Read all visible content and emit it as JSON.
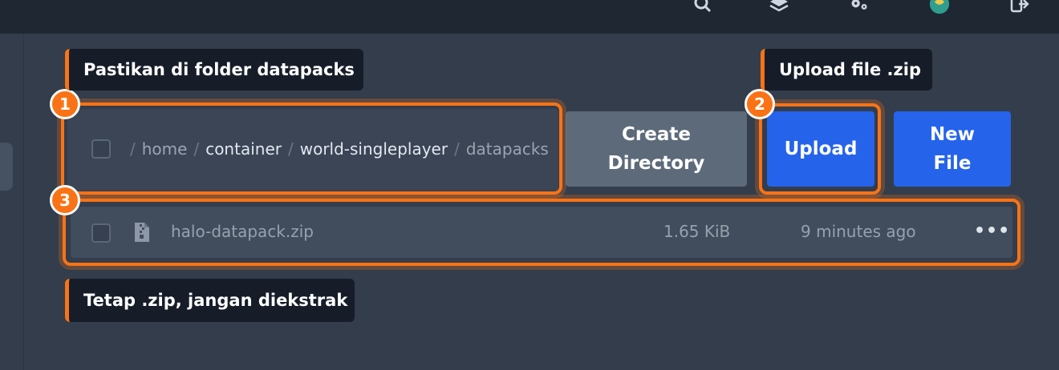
{
  "top_icons": [
    "search-icon",
    "layers-icon",
    "gears-icon",
    "avatar",
    "logout-icon"
  ],
  "breadcrumb": [
    {
      "text": "home",
      "style": "dim"
    },
    {
      "text": "container",
      "style": "bright"
    },
    {
      "text": "world-singleplayer",
      "style": "bright"
    },
    {
      "text": "datapacks",
      "style": "dim"
    }
  ],
  "breadcrumb_separator": "/",
  "buttons": {
    "create_directory": "Create Directory",
    "upload": "Upload",
    "new_file": "New File"
  },
  "file": {
    "name": "halo-datapack.zip",
    "size": "1.65 KiB",
    "modified": "9 minutes ago",
    "menu": "•••",
    "icon": "file-zip-icon"
  },
  "annotations": {
    "callout_1": "Pastikan di folder datapacks",
    "callout_2": "Upload file .zip",
    "callout_3": "Tetap .zip, jangan diekstrak",
    "badge_1": "1",
    "badge_2": "2",
    "badge_3": "3"
  },
  "colors": {
    "accent": "#f97316",
    "primary": "#2563eb",
    "secondary": "#5d6a7a",
    "background": "#333d4b",
    "topbar": "#1f2733"
  }
}
